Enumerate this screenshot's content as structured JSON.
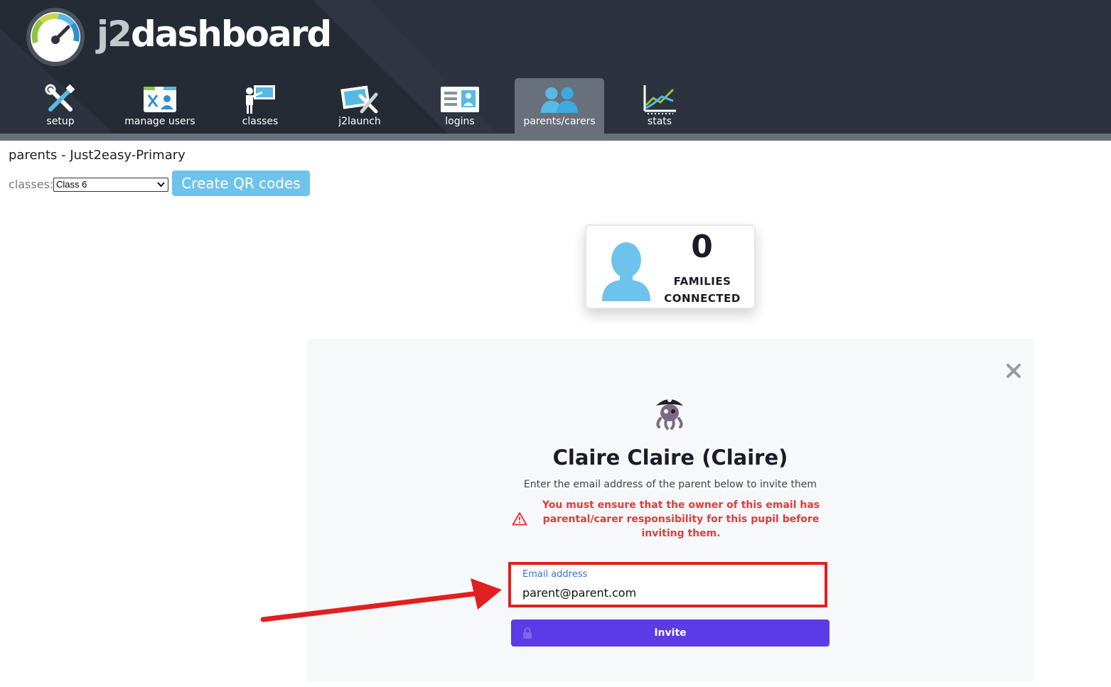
{
  "app": {
    "brand_prefix": "j2",
    "brand_suffix": "dashboard"
  },
  "nav": {
    "items": [
      {
        "label": "setup",
        "icon": "tools-icon"
      },
      {
        "label": "manage users",
        "icon": "manage-users-icon"
      },
      {
        "label": "classes",
        "icon": "teacher-board-icon"
      },
      {
        "label": "j2launch",
        "icon": "launch-tools-icon"
      },
      {
        "label": "logins",
        "icon": "id-card-icon"
      },
      {
        "label": "parents/carers",
        "icon": "parents-icon",
        "active": true
      },
      {
        "label": "stats",
        "icon": "chart-icon"
      }
    ]
  },
  "page": {
    "title": "parents - Just2easy-Primary",
    "classes_label": "classes:",
    "selected_class": "Class 6",
    "qr_button": "Create QR codes"
  },
  "families": {
    "count": "0",
    "label_line1": "FAMILIES",
    "label_line2": "CONNECTED"
  },
  "modal": {
    "pupil_name": "Claire Claire (Claire)",
    "instruction": "Enter the email address of the parent below to invite them",
    "warning": "You must ensure that the owner of this email has parental/carer responsibility for this pupil before inviting them.",
    "email_label": "Email address",
    "email_value": "parent@parent.com",
    "invite_button": "Invite"
  },
  "colors": {
    "header_bg": "#2c333e",
    "active_tab": "#68707b",
    "qr_button": "#6ec3ec",
    "invite_button": "#5b3be6",
    "warning": "#e23b3b",
    "highlight_box": "#e02020"
  }
}
